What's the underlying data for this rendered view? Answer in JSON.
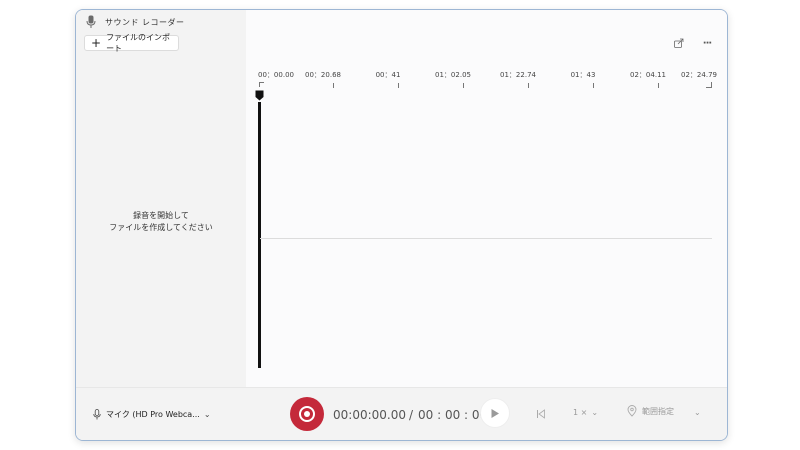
{
  "app": {
    "title": "サウンド レコーダー"
  },
  "sidebar": {
    "import_label": "ファイルのインポート",
    "empty_line1": "録音を開始して",
    "empty_line2": "ファイルを作成してください"
  },
  "toolbar": {
    "share_icon": "share-icon",
    "more_label": "···"
  },
  "timeline": {
    "ticks": [
      "00：00.00",
      "00：20.68",
      "00：41",
      "01：02.05",
      "01：22.74",
      "01：43",
      "02：04.11",
      "02：24.79"
    ]
  },
  "bottom": {
    "mic_label": "マイク (HD Pro Webca...",
    "current_time": "00:00:00.00",
    "separator": "/",
    "total_time": "00 : 00 : 00",
    "speed_label": "1 ×",
    "range_label": "範囲指定"
  },
  "colors": {
    "record": "#c4293a",
    "accent_border": "#9db6d4"
  }
}
